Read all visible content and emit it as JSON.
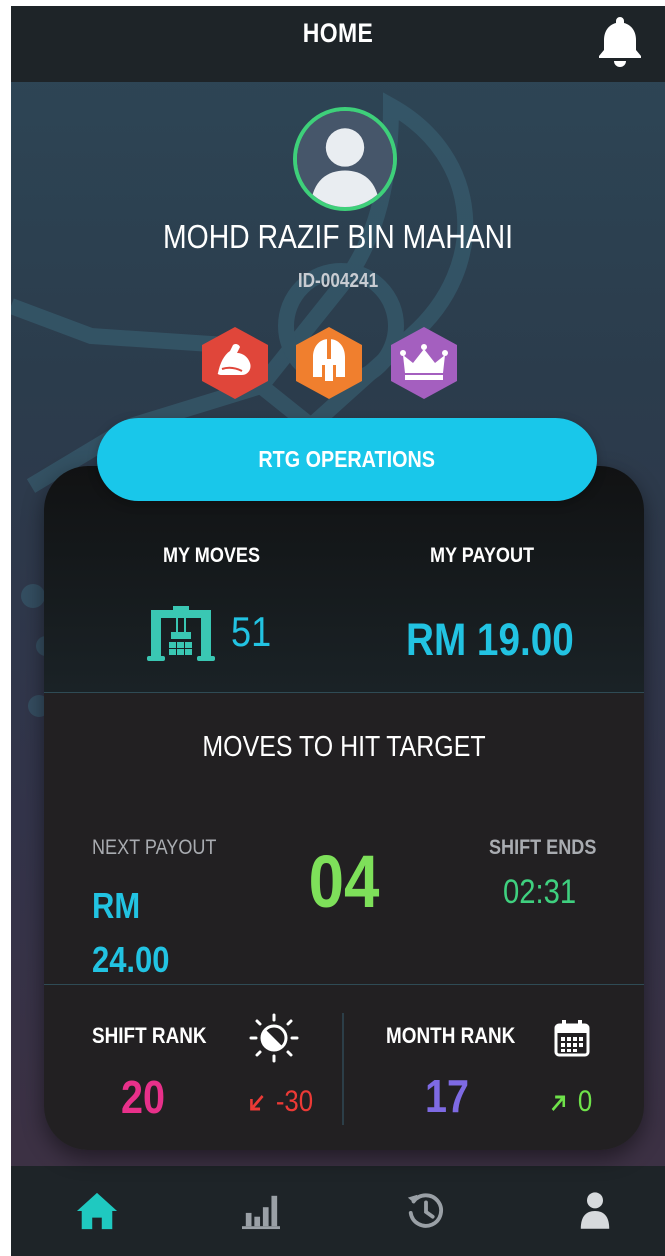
{
  "header": {
    "title": "HOME",
    "bell_icon": "bell-icon"
  },
  "profile": {
    "name": "MOHD RAZIF BIN MAHANI",
    "id": "ID-004241",
    "avatar_icon": "user-avatar-icon",
    "badges": [
      {
        "icon": "muscle-arm-icon",
        "color": "#e0463a"
      },
      {
        "icon": "spartan-helmet-icon",
        "color": "#f07f2e"
      },
      {
        "icon": "crown-icon",
        "color": "#a45fbf"
      }
    ]
  },
  "operation": {
    "label": "RTG OPERATIONS"
  },
  "stats": {
    "my_moves_label": "MY MOVES",
    "my_moves_value": "51",
    "my_payout_label": "MY PAYOUT",
    "my_payout_value": "RM 19.00",
    "crane_icon": "rtg-crane-icon"
  },
  "target": {
    "title": "MOVES TO HIT TARGET",
    "value": "04",
    "next_payout_label": "NEXT PAYOUT",
    "next_payout_value": "RM 24.00",
    "shift_ends_label": "SHIFT ENDS",
    "shift_ends_value": "02:31"
  },
  "ranks": {
    "shift_rank_label": "SHIFT RANK",
    "shift_rank_value": "20",
    "shift_rank_delta": "-30",
    "shift_icon": "day-night-icon",
    "month_rank_label": "MONTH RANK",
    "month_rank_value": "17",
    "month_rank_delta": "0",
    "month_icon": "calendar-icon"
  },
  "nav": {
    "items": [
      "home-icon",
      "leaderboard-icon",
      "history-icon",
      "profile-icon"
    ],
    "active": "home-icon"
  },
  "colors": {
    "accent": "#19c7ea",
    "green": "#7ee05a",
    "pink": "#e8308a",
    "purple": "#7e6ae3",
    "red": "#ec3a36"
  }
}
